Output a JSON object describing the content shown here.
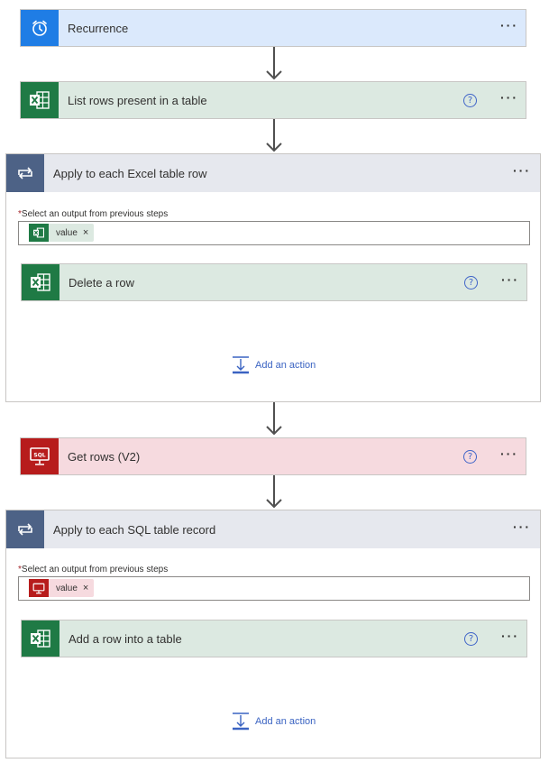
{
  "steps": {
    "recurrence": {
      "title": "Recurrence",
      "icon": "alarm-clock-icon"
    },
    "list_rows": {
      "title": "List rows present in a table",
      "icon": "excel-icon"
    },
    "apply_excel": {
      "title": "Apply to each Excel table row",
      "icon": "loop-icon",
      "field_label": "Select an output from previous steps",
      "required_mark": "*",
      "token": {
        "label": "value",
        "remove": "×",
        "icon": "excel-icon"
      },
      "inner": {
        "title": "Delete a row",
        "icon": "excel-icon"
      },
      "add_action": "Add an action"
    },
    "get_rows": {
      "title": "Get rows (V2)",
      "icon": "sql-icon"
    },
    "apply_sql": {
      "title": "Apply to each SQL table record",
      "icon": "loop-icon",
      "field_label": "Select an output from previous steps",
      "required_mark": "*",
      "token": {
        "label": "value",
        "remove": "×",
        "icon": "sql-icon"
      },
      "inner": {
        "title": "Add a row into a table",
        "icon": "excel-icon"
      },
      "add_action": "Add an action"
    }
  },
  "ui": {
    "more": "···",
    "help": "?"
  },
  "colors": {
    "excel": "#1f7a45",
    "sql": "#b71c1c",
    "timer": "#1f7de5",
    "loop": "#4d6286",
    "link": "#3a63c2"
  }
}
